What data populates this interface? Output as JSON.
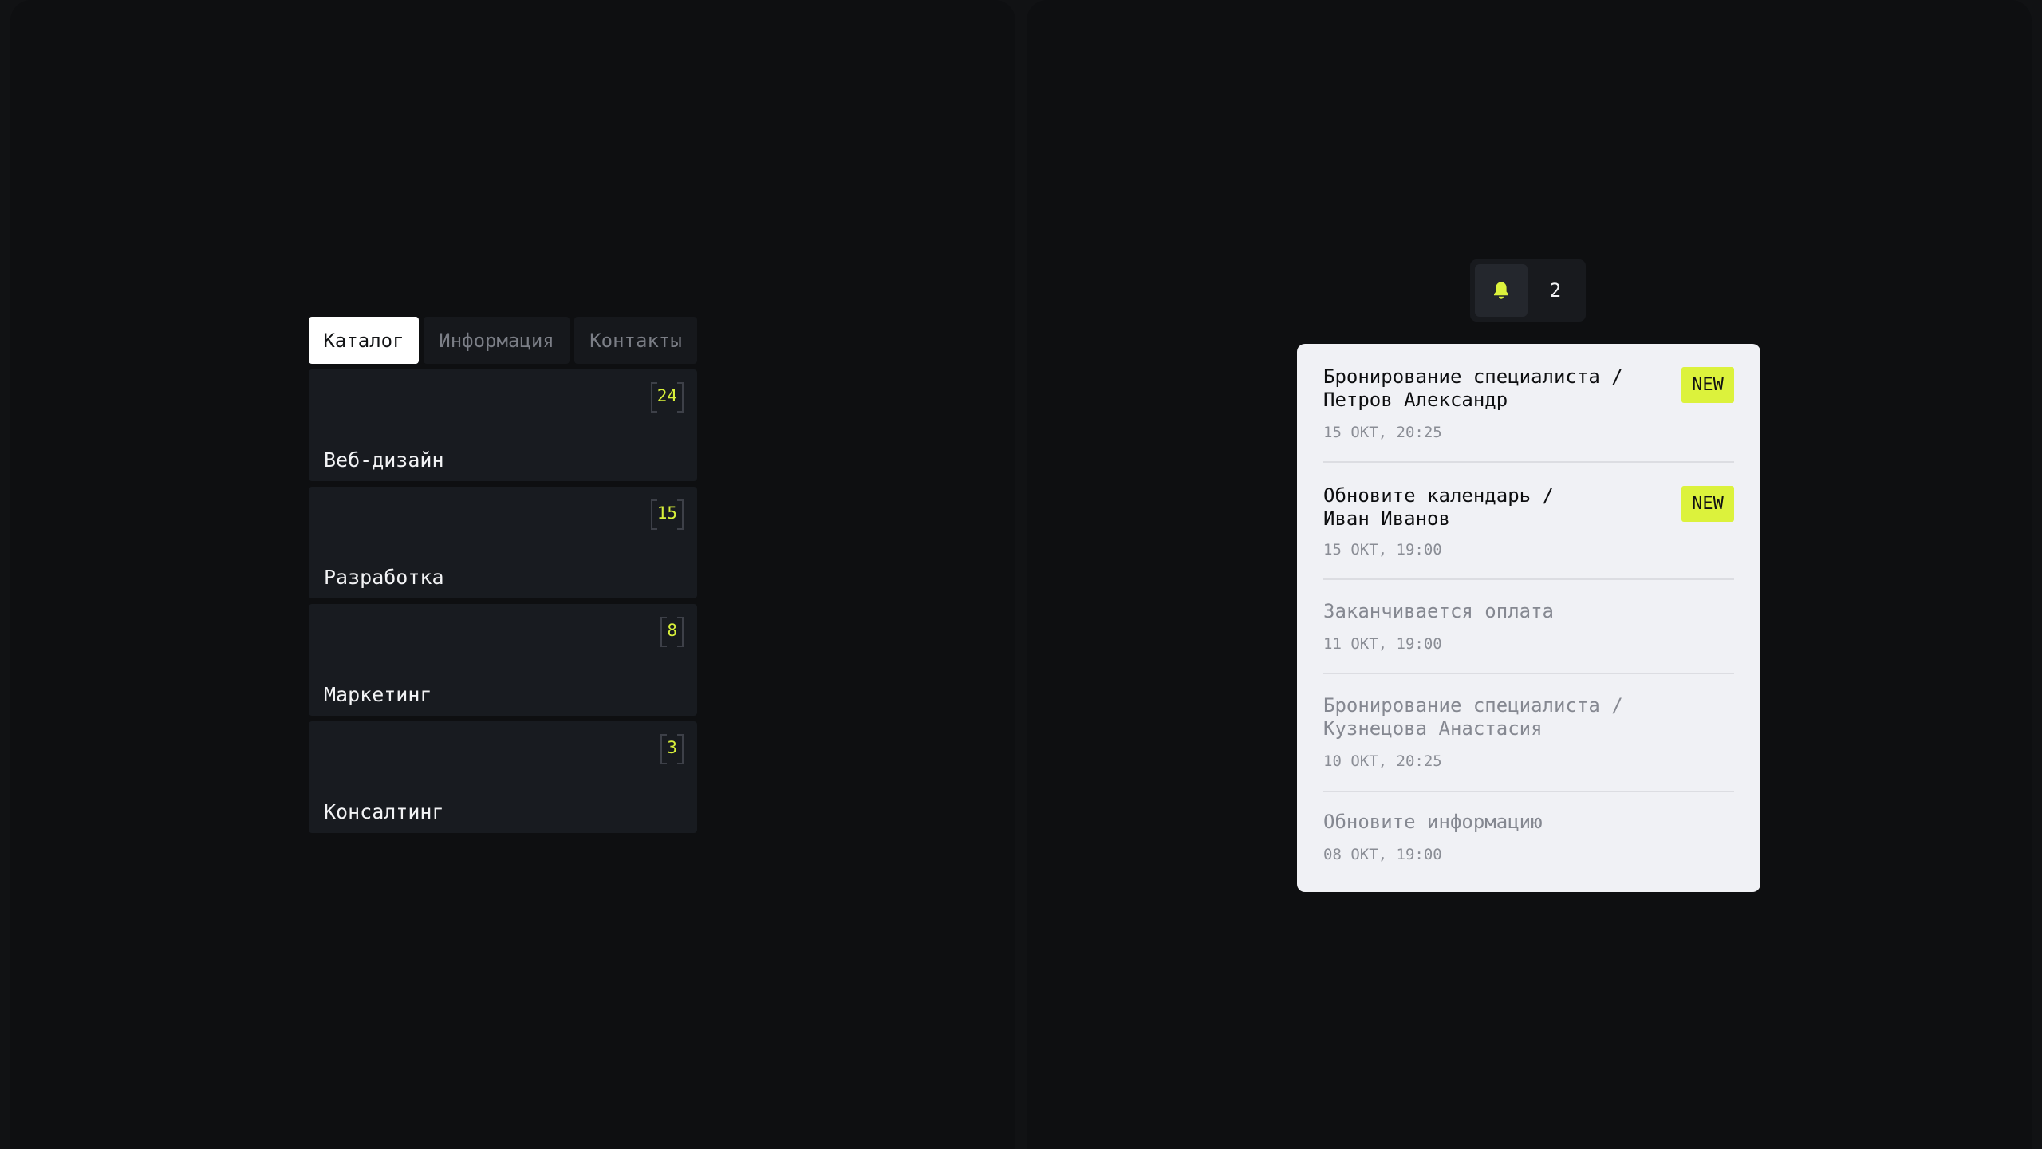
{
  "catalog": {
    "tabs": [
      {
        "label": "Каталог",
        "active": true
      },
      {
        "label": "Информация",
        "active": false
      },
      {
        "label": "Контакты",
        "active": false
      }
    ],
    "items": [
      {
        "label": "Веб-дизайн",
        "count": "24"
      },
      {
        "label": "Разработка",
        "count": "15"
      },
      {
        "label": "Маркетинг",
        "count": "8"
      },
      {
        "label": "Консалтинг",
        "count": "3"
      }
    ]
  },
  "notifications": {
    "bell_icon": "bell-icon",
    "count": "2",
    "badge_label": "NEW",
    "accent_color": "#dcf23c",
    "items": [
      {
        "title": "Бронирование специалиста /\nПетров Александр",
        "date": "15 ОКТ, 20:25",
        "unread": true
      },
      {
        "title": "Обновите календарь /\nИван Иванов",
        "date": "15 ОКТ, 19:00",
        "unread": true
      },
      {
        "title": "Заканчивается оплата",
        "date": "11 ОКТ, 19:00",
        "unread": false
      },
      {
        "title": "Бронирование специалиста /\nКузнецова Анастасия",
        "date": "10 ОКТ, 20:25",
        "unread": false
      },
      {
        "title": "Обновите информацию",
        "date": "08 ОКТ, 19:00",
        "unread": false
      }
    ]
  }
}
